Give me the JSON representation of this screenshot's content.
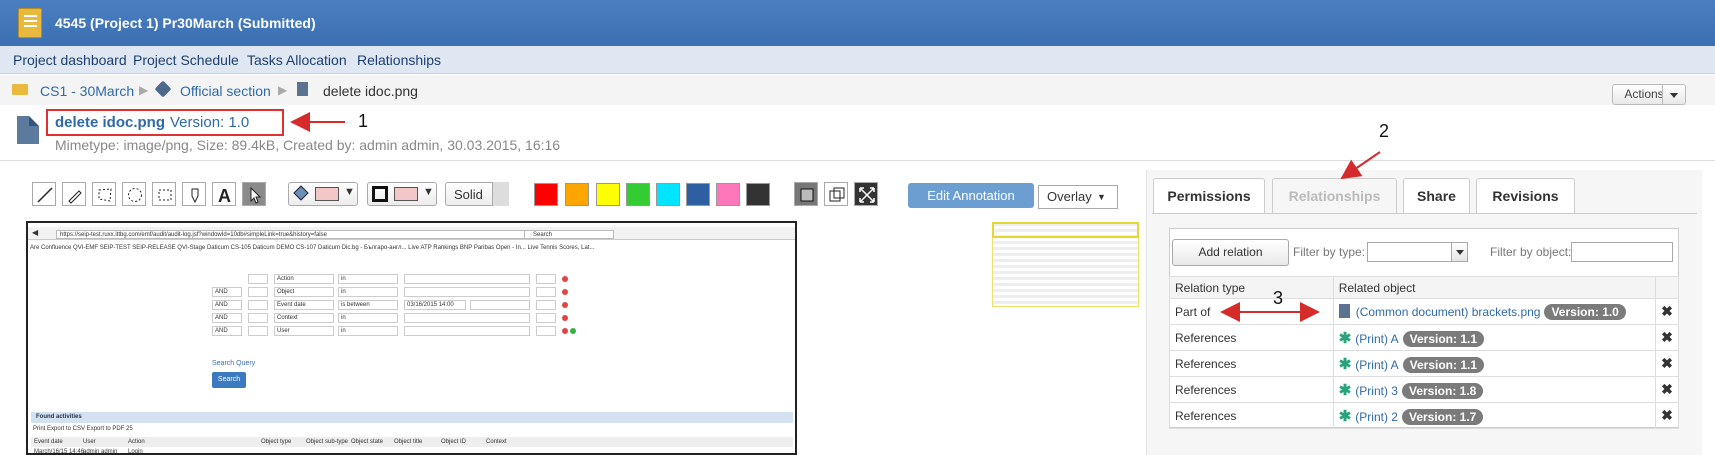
{
  "window": {
    "title": "4545 (Project 1) Pr30March (Submitted)"
  },
  "nav": {
    "items": [
      "Project dashboard",
      "Project Schedule",
      "Tasks Allocation",
      "Relationships"
    ]
  },
  "breadcrumb": {
    "items": [
      "CS1 - 30March",
      "Official section",
      "delete idoc.png"
    ]
  },
  "actions": {
    "label": "Actions"
  },
  "document": {
    "name": "delete idoc.png",
    "version": "Version: 1.0",
    "meta": "Mimetype: image/png, Size: 89.4kB, Created by: admin admin, 30.03.2015, 16:16"
  },
  "toolbar": {
    "line_style": "Solid",
    "edit_annotation": "Edit Annotation",
    "overlay": "Overlay",
    "colors": [
      "#ff0000",
      "#ffa500",
      "#ffff00",
      "#33cc33",
      "#00e5ff",
      "#2e5fa3",
      "#ff77bb",
      "#333333"
    ]
  },
  "embedded": {
    "url": "https://seip-test.ruxx.ittbg.com/emf/audit/audit-log.jsf?windowId=10db#simpleLink=true&history=false",
    "search_placeholder": "Search",
    "bookmarks": "Are  Confluence  QVI-EMF  SEIP-TEST  SEIP-RELEASE  QVI-Stage Daticum  CS-105 Daticum  DEMO  CS-107 Daticum  Dic.bg - Българо-англ...  Live ATP Rankings  BNP Paribas Open - In...  Live Tennis Scores, Lat...",
    "filters": [
      {
        "op": "",
        "field": "Action",
        "cond": "in",
        "value": ""
      },
      {
        "op": "AND",
        "field": "Object",
        "cond": "in",
        "value": ""
      },
      {
        "op": "AND",
        "field": "Event date",
        "cond": "is between",
        "value": "03/16/2015 14:00"
      },
      {
        "op": "AND",
        "field": "Context",
        "cond": "in",
        "value": ""
      },
      {
        "op": "AND",
        "field": "User",
        "cond": "in",
        "value": ""
      }
    ],
    "search_query": "Search Query",
    "search_button": "Search",
    "found": "Found activities",
    "tools": "Print    Export to CSV    Export to PDF    25",
    "columns": [
      "Event date",
      "User",
      "Action",
      "Object type",
      "Object sub-type",
      "Object state",
      "Object title",
      "Object ID",
      "Context"
    ],
    "first_row": {
      "date": "March/16/15 14:46",
      "user": "admin admin",
      "action": "Login"
    }
  },
  "panel": {
    "tabs": [
      "Permissions",
      "Relationships",
      "Share",
      "Revisions"
    ],
    "add_relation": "Add relation",
    "filter_type_label": "Filter by type:",
    "filter_object_label": "Filter by object:",
    "columns": [
      "Relation type",
      "Related object"
    ],
    "rows": [
      {
        "type": "Part of",
        "object": "(Common document) brackets.png",
        "version": "Version: 1.0",
        "icon": "document-icon"
      },
      {
        "type": "References",
        "object": "(Print) A",
        "version": "Version: 1.1",
        "icon": "gear-icon"
      },
      {
        "type": "References",
        "object": "(Print) A",
        "version": "Version: 1.1",
        "icon": "gear-icon"
      },
      {
        "type": "References",
        "object": "(Print) 3",
        "version": "Version: 1.8",
        "icon": "gear-icon"
      },
      {
        "type": "References",
        "object": "(Print) 2",
        "version": "Version: 1.7",
        "icon": "gear-icon"
      }
    ],
    "delete_glyph": "✖"
  },
  "callouts": [
    "1",
    "2",
    "3"
  ]
}
